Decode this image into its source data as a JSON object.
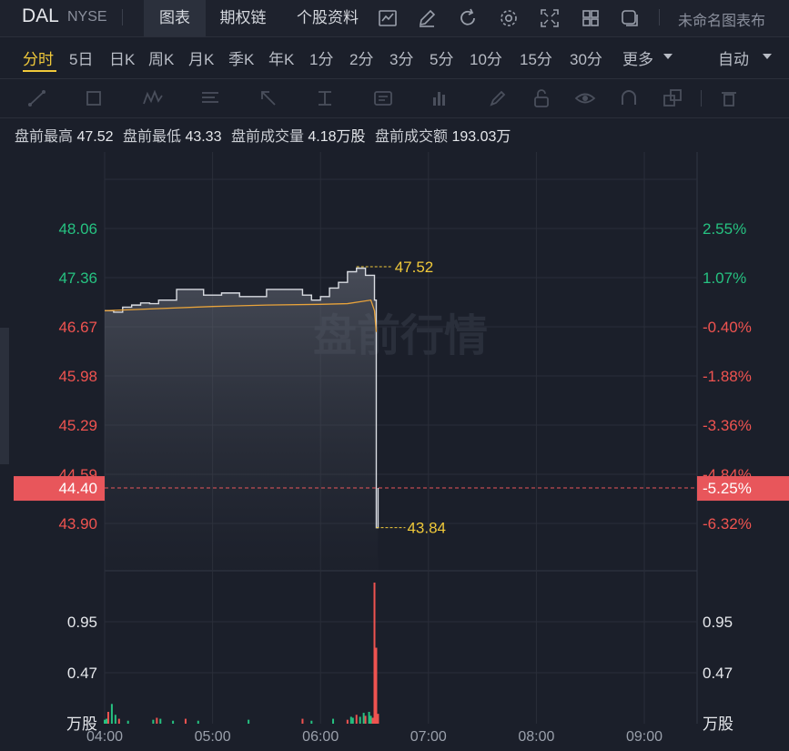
{
  "header": {
    "ticker": "DAL",
    "exchange": "NYSE",
    "tabs": [
      "图表",
      "期权链",
      "个股资料"
    ],
    "untitled_label": "未命名图表布"
  },
  "periods": [
    "分时",
    "5日",
    "日K",
    "周K",
    "月K",
    "季K",
    "年K",
    "1分",
    "2分",
    "3分",
    "5分",
    "10分",
    "15分",
    "30分",
    "更多"
  ],
  "active_period": "分时",
  "auto_label": "自动",
  "stats": {
    "high_label": "盘前最高",
    "high_value": "47.52",
    "low_label": "盘前最低",
    "low_value": "43.33",
    "volume_label": "盘前成交量",
    "volume_value": "4.18万股",
    "amount_label": "盘前成交额",
    "amount_value": "193.03万"
  },
  "watermark": "盘前行情",
  "colors": {
    "up": "#26c281",
    "down": "#ef5350",
    "accent": "#f0c93a",
    "avg_line": "#e8a33b",
    "price_line": "#d9dce2",
    "current_tag": "#e8565b"
  },
  "chart_data": {
    "type": "line",
    "x_ticks": [
      "04:00",
      "05:00",
      "06:00",
      "07:00",
      "08:00",
      "09:00"
    ],
    "price_ticks": [
      "48.06",
      "47.36",
      "46.67",
      "45.98",
      "45.29",
      "44.59",
      "43.90"
    ],
    "pct_ticks": [
      "2.55%",
      "1.07%",
      "-0.40%",
      "-1.88%",
      "-3.36%",
      "-4.84%",
      "-6.32%"
    ],
    "price_range": [
      43.9,
      48.06
    ],
    "volume_ticks": [
      "0.95",
      "0.47"
    ],
    "volume_unit": "万股",
    "volume_range": [
      0,
      1.43
    ],
    "current_price": "44.40",
    "current_pct": "-5.25%",
    "high_marker": "47.52",
    "low_marker": "43.84",
    "price_series": [
      [
        "04:00",
        46.9
      ],
      [
        "04:05",
        46.88
      ],
      [
        "04:10",
        46.95
      ],
      [
        "04:15",
        46.98
      ],
      [
        "04:20",
        47.01
      ],
      [
        "04:25",
        47.0
      ],
      [
        "04:30",
        47.05
      ],
      [
        "04:35",
        47.05
      ],
      [
        "04:40",
        47.2
      ],
      [
        "04:45",
        47.2
      ],
      [
        "04:50",
        47.2
      ],
      [
        "04:55",
        47.12
      ],
      [
        "05:00",
        47.12
      ],
      [
        "05:05",
        47.15
      ],
      [
        "05:10",
        47.15
      ],
      [
        "05:15",
        47.1
      ],
      [
        "05:20",
        47.1
      ],
      [
        "05:25",
        47.1
      ],
      [
        "05:30",
        47.2
      ],
      [
        "05:35",
        47.2
      ],
      [
        "05:40",
        47.2
      ],
      [
        "05:45",
        47.2
      ],
      [
        "05:50",
        47.12
      ],
      [
        "05:55",
        47.05
      ],
      [
        "06:00",
        47.1
      ],
      [
        "06:05",
        47.22
      ],
      [
        "06:10",
        47.3
      ],
      [
        "06:15",
        47.45
      ],
      [
        "06:20",
        47.5
      ],
      [
        "06:25",
        47.4
      ],
      [
        "06:30",
        47.05
      ],
      [
        "06:31",
        43.84
      ],
      [
        "06:32",
        44.4
      ]
    ],
    "avg_series": [
      [
        "04:00",
        46.9
      ],
      [
        "04:30",
        46.93
      ],
      [
        "05:00",
        46.96
      ],
      [
        "05:30",
        46.98
      ],
      [
        "06:00",
        46.99
      ],
      [
        "06:15",
        47.0
      ],
      [
        "06:28",
        47.05
      ],
      [
        "06:30",
        46.9
      ],
      [
        "06:31",
        46.6
      ]
    ],
    "volume_series": [
      [
        "04:00",
        0.04
      ],
      [
        "04:01",
        0.05
      ],
      [
        "04:02",
        0.12
      ],
      [
        "04:04",
        0.2
      ],
      [
        "04:06",
        0.09
      ],
      [
        "04:08",
        0.05
      ],
      [
        "04:13",
        0.03
      ],
      [
        "04:27",
        0.04
      ],
      [
        "04:29",
        0.06
      ],
      [
        "04:31",
        0.05
      ],
      [
        "04:38",
        0.03
      ],
      [
        "04:45",
        0.05
      ],
      [
        "04:52",
        0.03
      ],
      [
        "05:20",
        0.04
      ],
      [
        "05:50",
        0.05
      ],
      [
        "05:55",
        0.03
      ],
      [
        "06:07",
        0.05
      ],
      [
        "06:15",
        0.04
      ],
      [
        "06:17",
        0.07
      ],
      [
        "06:18",
        0.06
      ],
      [
        "06:20",
        0.09
      ],
      [
        "06:22",
        0.07
      ],
      [
        "06:24",
        0.11
      ],
      [
        "06:25",
        0.08
      ],
      [
        "06:27",
        0.12
      ],
      [
        "06:28",
        0.08
      ],
      [
        "06:29",
        0.06
      ],
      [
        "06:30",
        1.43
      ],
      [
        "06:31",
        0.77
      ],
      [
        "06:32",
        0.1
      ]
    ]
  }
}
